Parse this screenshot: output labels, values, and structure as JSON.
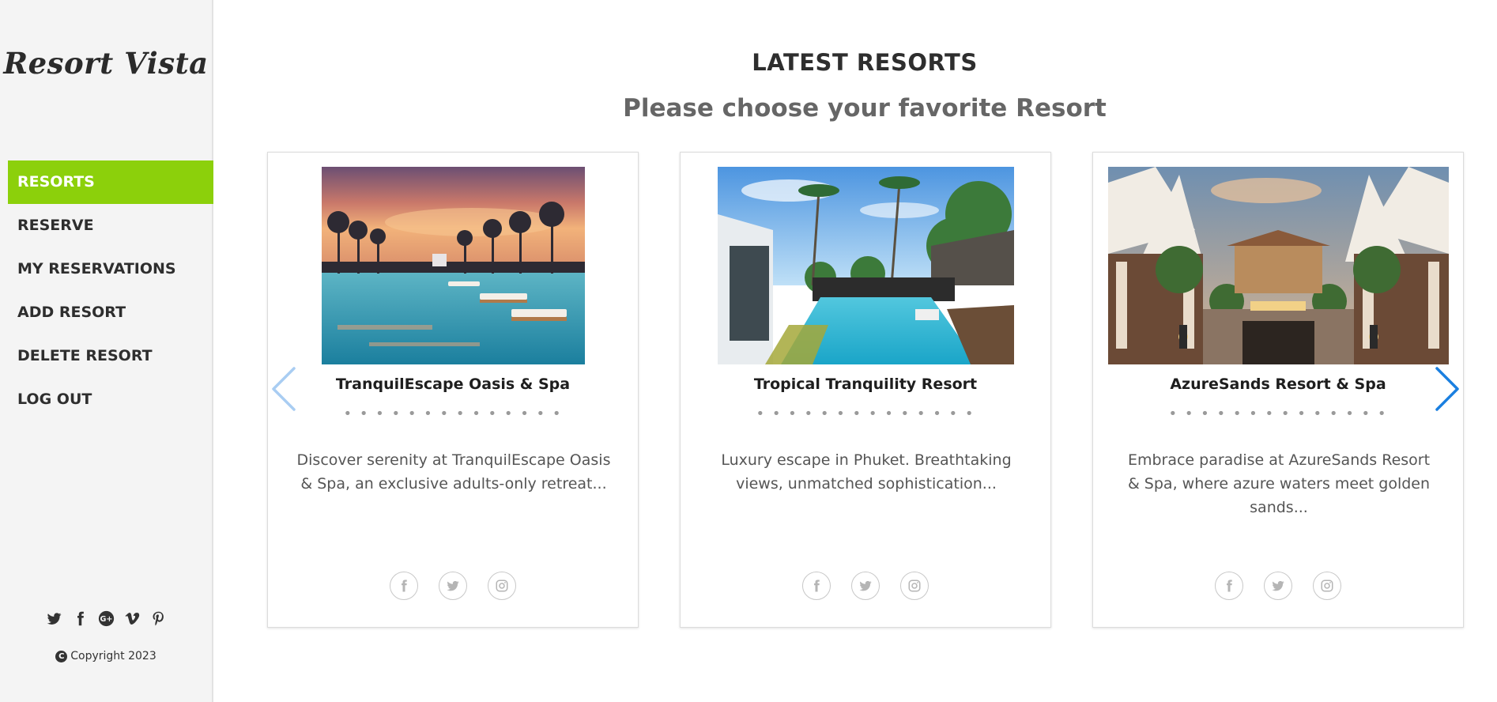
{
  "sidebar": {
    "logo": "Resort Vista",
    "nav": [
      {
        "label": "RESORTS",
        "active": true
      },
      {
        "label": "RESERVE",
        "active": false
      },
      {
        "label": "MY RESERVATIONS",
        "active": false
      },
      {
        "label": "ADD RESORT",
        "active": false
      },
      {
        "label": "DELETE RESORT",
        "active": false
      },
      {
        "label": "LOG OUT",
        "active": false
      }
    ],
    "social_icons": [
      "twitter-icon",
      "facebook-icon",
      "google-plus-icon",
      "vimeo-icon",
      "pinterest-icon"
    ],
    "copyright_symbol": "C",
    "copyright": "Copyright 2023"
  },
  "main": {
    "title": "LATEST RESORTS",
    "subtitle": "Please choose your favorite Resort",
    "cards": [
      {
        "name": "TranquilEscape Oasis & Spa",
        "dots": "• • • • • • • • • • • • • •",
        "description": "Discover serenity at TranquilEscape Oasis & Spa, an exclusive adults-only retreat...",
        "image": "sunset-infinity-pool-photo",
        "social_icons": [
          "facebook-icon",
          "twitter-icon",
          "instagram-icon"
        ]
      },
      {
        "name": "Tropical Tranquility Resort",
        "dots": "• • • • • • • • • • • • • •",
        "description": "Luxury escape in Phuket. Breathtaking views, unmatched sophistication...",
        "image": "villa-pool-palms-photo",
        "social_icons": [
          "facebook-icon",
          "twitter-icon",
          "instagram-icon"
        ]
      },
      {
        "name": "AzureSands Resort & Spa",
        "dots": "• • • • • • • • • • • • • •",
        "description": "Embrace paradise at AzureSands Resort & Spa, where azure waters meet golden sands...",
        "image": "tented-courtyard-photo",
        "social_icons": [
          "facebook-icon",
          "twitter-icon",
          "instagram-icon"
        ]
      }
    ],
    "carousel": {
      "prev_icon": "chevron-left-icon",
      "next_icon": "chevron-right-icon"
    }
  },
  "colors": {
    "accent": "#8cd00b",
    "sidebar_bg": "#f4f4f4",
    "arrow_prev": "#a9cdf2",
    "arrow_next": "#1a7fe0"
  }
}
